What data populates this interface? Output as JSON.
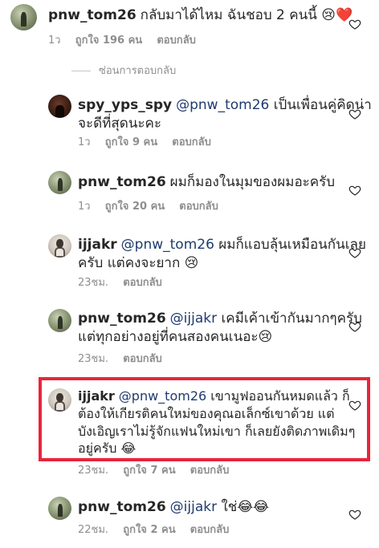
{
  "comments": [
    {
      "user": "pnw_tom26",
      "body": "กลับมาได้ไหม ฉันชอบ 2 คนนี้ 😢❤️",
      "time": "1ว",
      "likes": "ถูกใจ 196 คน",
      "reply": "ตอบกลับ"
    },
    {
      "user": "spy_yps_spy",
      "mention": "@pnw_tom26",
      "body_line1": "เป็นเพื่อนคู่คิดน่า",
      "body_line2": "จะดีที่สุดนะคะ",
      "time": "1ว",
      "likes": "ถูกใจ 9 คน",
      "reply": "ตอบกลับ"
    },
    {
      "user": "pnw_tom26",
      "body": "ผมก็มองในมุมของผมอะครับ",
      "time": "1ว",
      "likes": "ถูกใจ 20 คน",
      "reply": "ตอบกลับ"
    },
    {
      "user": "ijjakr",
      "mention": "@pnw_tom26",
      "body_line1": "ผมก็แอบลุ้นเหมือนกันเลย",
      "body_line2": "ครับ แต่คงจะยาก 😢",
      "time": "23ชม.",
      "reply": "ตอบกลับ"
    },
    {
      "user": "pnw_tom26",
      "mention": "@ijjakr",
      "body_line1": "เคมีเค้าเข้ากันมากๆครับ",
      "body_line2": "แต่ทุกอย่างอยู่ที่คนสองคนเนอะ😢",
      "time": "23ชม.",
      "reply": "ตอบกลับ"
    },
    {
      "user": "ijjakr",
      "mention": "@pnw_tom26",
      "body_line1": "เขามูฟออนกันหมดแล้ว ก็",
      "body_line2": "ต้องให้เกียรติคนใหม่ของคุณอเล็กซ์เขาด้วย แต่",
      "body_line3": "บังเอิญเราไม่รู้จักแฟนใหม่เขา ก็เลยยังติดภาพเดิมๆ",
      "body_line4": "อยู่ครับ 😂",
      "time": "23ชม.",
      "likes": "ถูกใจ 7 คน",
      "reply": "ตอบกลับ"
    },
    {
      "user": "pnw_tom26",
      "mention": "@ijjakr",
      "body": "ใช่😂😂",
      "time": "22ชม.",
      "likes": "ถูกใจ 2 คน",
      "reply": "ตอบกลับ"
    }
  ],
  "hide_replies": "ซ่อนการตอบกลับ",
  "colors": {
    "highlight": "#e8253b",
    "meta": "#8e8e8e",
    "mention": "#1f3b6e"
  }
}
